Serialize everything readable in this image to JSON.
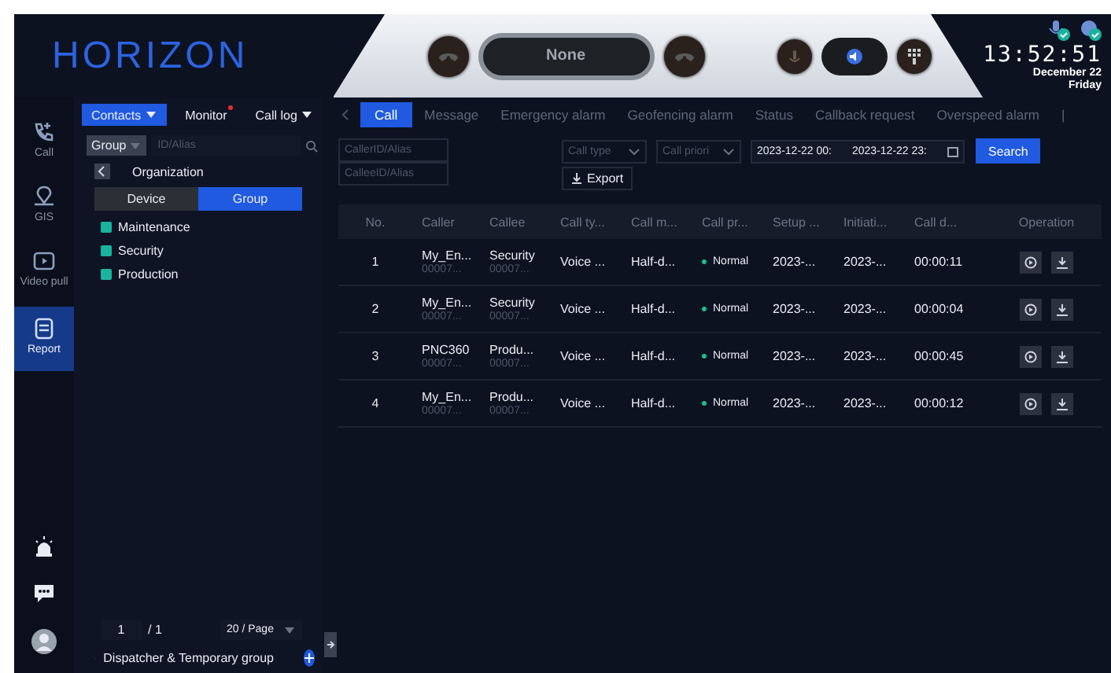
{
  "logo": "HORIZON",
  "control_bar": {
    "status": "None"
  },
  "clock": {
    "time": "13:52:51",
    "date": "December 22",
    "weekday": "Friday"
  },
  "rail": [
    {
      "label": "Call",
      "selected": false
    },
    {
      "label": "GIS",
      "selected": false
    },
    {
      "label": "Video pull",
      "selected": false
    },
    {
      "label": "Report",
      "selected": true
    }
  ],
  "contact_tabs": [
    {
      "label": "Contacts",
      "selected": true,
      "dropdown": true,
      "alert": false
    },
    {
      "label": "Monitor",
      "selected": false,
      "dropdown": false,
      "alert": true
    },
    {
      "label": "Call log",
      "selected": false,
      "dropdown": true,
      "alert": false
    }
  ],
  "search": {
    "scope": "Group",
    "placeholder": "ID/Alias"
  },
  "organization": {
    "title": "Organization"
  },
  "segments": [
    {
      "label": "Device",
      "selected": false
    },
    {
      "label": "Group",
      "selected": true
    }
  ],
  "groups": [
    {
      "name": "Maintenance"
    },
    {
      "name": "Security"
    },
    {
      "name": "Production"
    }
  ],
  "pagination": {
    "page": "1",
    "total": "/ 1",
    "page_size": "20 / Page"
  },
  "dispatcher": {
    "label": "Dispatcher & Temporary group"
  },
  "tabs": [
    {
      "label": "Call",
      "selected": true
    },
    {
      "label": "Message",
      "selected": false
    },
    {
      "label": "Emergency alarm",
      "selected": false
    },
    {
      "label": "Geofencing alarm",
      "selected": false
    },
    {
      "label": "Status",
      "selected": false
    },
    {
      "label": "Callback request",
      "selected": false
    },
    {
      "label": "Overspeed alarm",
      "selected": false
    },
    {
      "label": "|",
      "selected": false
    }
  ],
  "filters": {
    "caller_placeholder": "CallerID/Alias",
    "callee_placeholder": "CalleeID/Alias",
    "call_type_placeholder": "Call type",
    "call_priority_placeholder": "Call priori",
    "start": "2023-12-22 00:",
    "end": "2023-12-22 23:",
    "search": "Search",
    "export": "Export"
  },
  "table": {
    "columns": [
      "No.",
      "Caller",
      "Callee",
      "Call ty...",
      "Call m...",
      "Call pr...",
      "Setup ...",
      "Initiati...",
      "Call d...",
      "Operation"
    ],
    "rows": [
      {
        "no": "1",
        "caller": "My_En...",
        "caller_id": "00007...",
        "callee": "Security",
        "callee_id": "00007...",
        "call_type": "Voice ...",
        "call_mode": "Half-d...",
        "priority": "Normal",
        "setup": "2023-...",
        "initiation": "2023-...",
        "duration": "00:00:11"
      },
      {
        "no": "2",
        "caller": "My_En...",
        "caller_id": "00007...",
        "callee": "Security",
        "callee_id": "00007...",
        "call_type": "Voice ...",
        "call_mode": "Half-d...",
        "priority": "Normal",
        "setup": "2023-...",
        "initiation": "2023-...",
        "duration": "00:00:04"
      },
      {
        "no": "3",
        "caller": "PNC360",
        "caller_id": "00007...",
        "callee": "Produ...",
        "callee_id": "00007...",
        "call_type": "Voice ...",
        "call_mode": "Half-d...",
        "priority": "Normal",
        "setup": "2023-...",
        "initiation": "2023-...",
        "duration": "00:00:45"
      },
      {
        "no": "4",
        "caller": "My_En...",
        "caller_id": "00007...",
        "callee": "Produ...",
        "callee_id": "00007...",
        "call_type": "Voice ...",
        "call_mode": "Half-d...",
        "priority": "Normal",
        "setup": "2023-...",
        "initiation": "2023-...",
        "duration": "00:00:12"
      }
    ]
  }
}
